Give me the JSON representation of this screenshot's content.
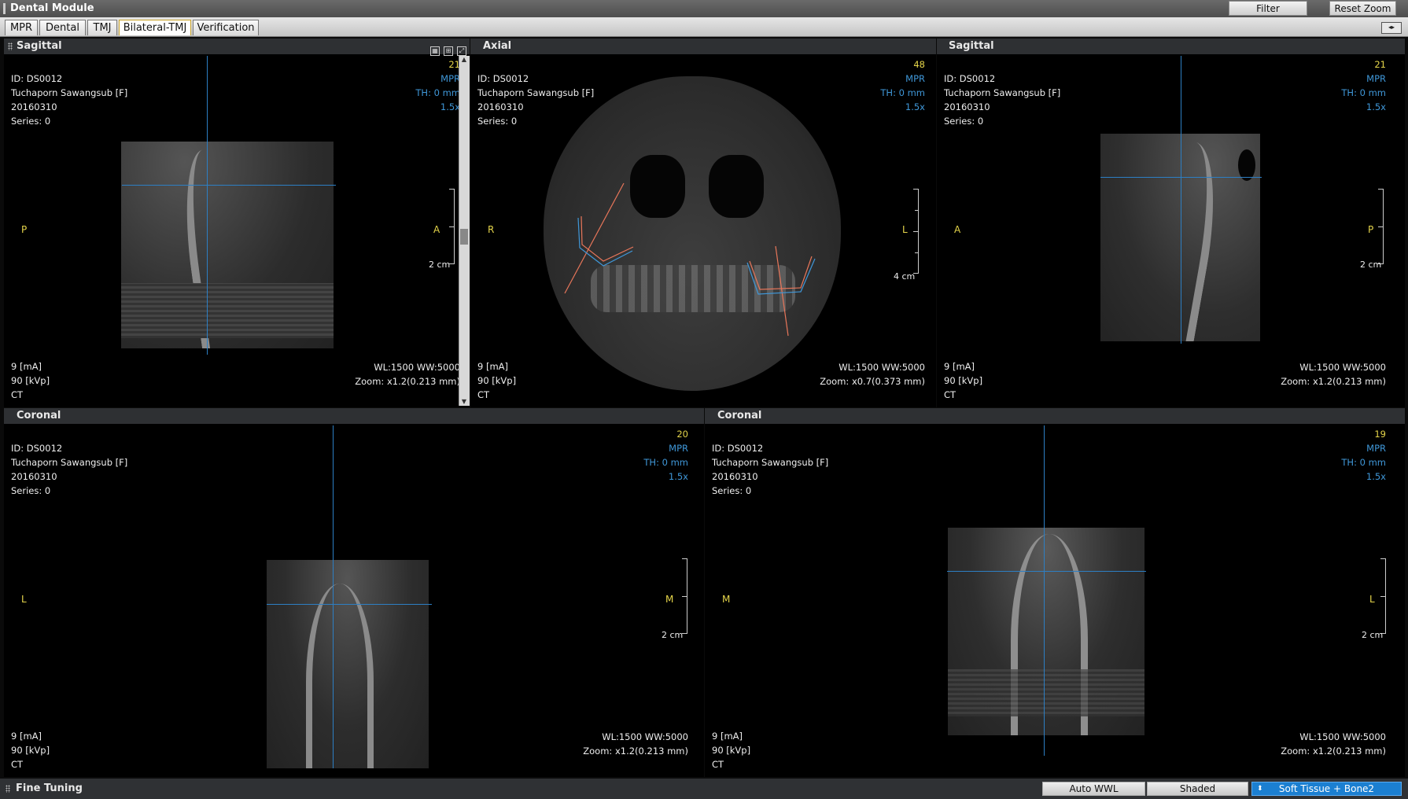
{
  "app": {
    "title": "Dental Module",
    "filter_label": "Filter",
    "reset_zoom_label": "Reset Zoom"
  },
  "tabs": [
    {
      "label": "MPR"
    },
    {
      "label": "Dental"
    },
    {
      "label": "TMJ"
    },
    {
      "label": "Bilateral-TMJ",
      "active": true
    },
    {
      "label": "Verification"
    }
  ],
  "patient": {
    "id": "ID: DS0012",
    "name": "Tuchaporn Sawangsub [F]",
    "date": "20160310",
    "series": "Series: 0",
    "ma": "9 [mA]",
    "kvp": "90 [kVp]",
    "modality": "CT",
    "mode": "MPR",
    "thickness": "TH: 0 mm",
    "mag": "1.5x",
    "wlww": "WL:1500 WW:5000"
  },
  "views": {
    "sagittal_left": {
      "title": "Sagittal",
      "slice": "21",
      "zoom": "Zoom: x1.2(0.213 mm)",
      "left_label": "P",
      "right_label": "A",
      "scale": "2 cm"
    },
    "axial": {
      "title": "Axial",
      "slice": "48",
      "zoom": "Zoom: x0.7(0.373 mm)",
      "left_label": "R",
      "right_label": "L",
      "scale": "4 cm"
    },
    "sagittal_right": {
      "title": "Sagittal",
      "slice": "21",
      "zoom": "Zoom: x1.2(0.213 mm)",
      "left_label": "A",
      "right_label": "P",
      "scale": "2 cm"
    },
    "coronal_left": {
      "title": "Coronal",
      "slice": "20",
      "zoom": "Zoom: x1.2(0.213 mm)",
      "left_label": "L",
      "right_label": "M",
      "scale": "2 cm"
    },
    "coronal_right": {
      "title": "Coronal",
      "slice": "19",
      "zoom": "Zoom: x1.2(0.213 mm)",
      "left_label": "M",
      "right_label": "L",
      "scale": "2 cm"
    }
  },
  "footer": {
    "title": "Fine Tuning",
    "auto_wwl": "Auto WWL",
    "shaded": "Shaded",
    "preset": "Soft Tissue + Bone2"
  },
  "colors": {
    "crosshair": "#2d7fc4",
    "annotation": "#e5d54a",
    "info_blue": "#3f97d8",
    "selected_preset": "#1b7fd1"
  }
}
